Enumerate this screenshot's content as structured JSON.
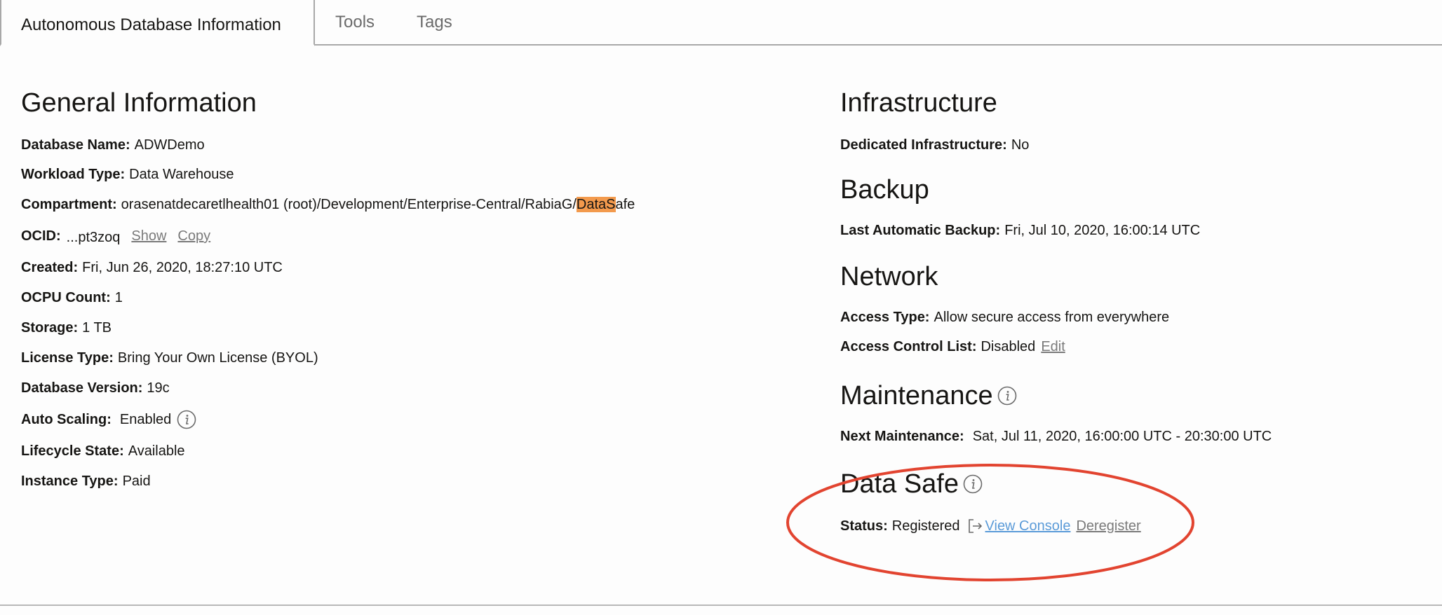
{
  "tabs": {
    "active": "Autonomous Database Information",
    "tools": "Tools",
    "tags": "Tags"
  },
  "general": {
    "title": "General Information",
    "database_name": {
      "label": "Database Name:",
      "value": "ADWDemo"
    },
    "workload_type": {
      "label": "Workload Type:",
      "value": "Data Warehouse"
    },
    "compartment": {
      "label": "Compartment:",
      "value_prefix": "orasenatdecaretlhealth01 (root)/Development/Enterprise-Central/RabiaG/",
      "value_highlight": "DataS",
      "value_suffix": "afe"
    },
    "ocid": {
      "label": "OCID:",
      "value": "...pt3zoq",
      "show": "Show",
      "copy": "Copy"
    },
    "created": {
      "label": "Created:",
      "value": "Fri, Jun 26, 2020, 18:27:10 UTC"
    },
    "ocpu_count": {
      "label": "OCPU Count:",
      "value": "1"
    },
    "storage": {
      "label": "Storage:",
      "value": "1 TB"
    },
    "license_type": {
      "label": "License Type:",
      "value": "Bring Your Own License (BYOL)"
    },
    "database_version": {
      "label": "Database Version:",
      "value": "19c"
    },
    "auto_scaling": {
      "label": "Auto Scaling:",
      "value": "Enabled"
    },
    "lifecycle_state": {
      "label": "Lifecycle State:",
      "value": "Available"
    },
    "instance_type": {
      "label": "Instance Type:",
      "value": "Paid"
    }
  },
  "infrastructure": {
    "title": "Infrastructure",
    "dedicated": {
      "label": "Dedicated Infrastructure:",
      "value": "No"
    }
  },
  "backup": {
    "title": "Backup",
    "last_automatic": {
      "label": "Last Automatic Backup:",
      "value": "Fri, Jul 10, 2020, 16:00:14 UTC"
    }
  },
  "network": {
    "title": "Network",
    "access_type": {
      "label": "Access Type:",
      "value": "Allow secure access from everywhere"
    },
    "acl": {
      "label": "Access Control List:",
      "value": "Disabled",
      "edit": "Edit"
    }
  },
  "maintenance": {
    "title": "Maintenance",
    "next": {
      "label": "Next Maintenance:",
      "value": "Sat, Jul 11, 2020, 16:00:00 UTC - 20:30:00 UTC"
    }
  },
  "data_safe": {
    "title": "Data Safe",
    "status": {
      "label": "Status:",
      "value": "Registered",
      "view_console": "View Console",
      "deregister": "Deregister"
    }
  },
  "icons": {
    "info": "info-icon",
    "external": "external-link-icon"
  },
  "colors": {
    "highlight": "#f39a4d",
    "annotation": "#e24430",
    "link_blue": "#5b9bd8",
    "link_gray": "#7a7a7a"
  }
}
